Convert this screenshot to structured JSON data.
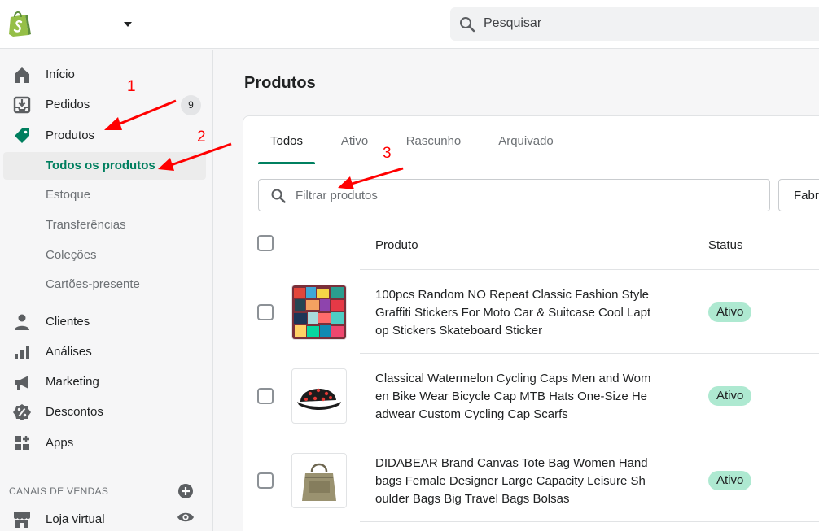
{
  "topbar": {
    "search_label": "Pesquisar"
  },
  "sidebar": {
    "items": [
      {
        "label": "Início",
        "icon": "home-icon"
      },
      {
        "label": "Pedidos",
        "icon": "orders-icon",
        "badge": "9"
      },
      {
        "label": "Produtos",
        "icon": "tag-icon"
      }
    ],
    "sub_items": [
      {
        "label": "Todos os produtos",
        "active": true
      },
      {
        "label": "Estoque"
      },
      {
        "label": "Transferências"
      },
      {
        "label": "Coleções"
      },
      {
        "label": "Cartões-presente"
      }
    ],
    "items2": [
      {
        "label": "Clientes",
        "icon": "person-icon"
      },
      {
        "label": "Análises",
        "icon": "bar-chart-icon"
      },
      {
        "label": "Marketing",
        "icon": "megaphone-icon"
      },
      {
        "label": "Descontos",
        "icon": "discount-icon"
      },
      {
        "label": "Apps",
        "icon": "apps-icon"
      }
    ],
    "section_title": "CANAIS DE VENDAS",
    "channel": {
      "label": "Loja virtual",
      "icon": "store-icon"
    }
  },
  "main": {
    "title": "Produtos",
    "tabs": [
      {
        "label": "Todos",
        "active": true
      },
      {
        "label": "Ativo"
      },
      {
        "label": "Rascunho"
      },
      {
        "label": "Arquivado"
      }
    ],
    "filter_placeholder": "Filtrar produtos",
    "vendor_label": "Fabr",
    "columns": {
      "product": "Produto",
      "status": "Status"
    },
    "products": [
      {
        "title": "100pcs Random NO Repeat Classic Fashion Style Graffiti Stickers For Moto Car & Suitcase Cool Laptop Stickers Skateboard Sticker",
        "status": "Ativo",
        "thumb": "stickers"
      },
      {
        "title": "Classical Watermelon Cycling Caps Men and Women Bike Wear Bicycle Cap MTB Hats One-Size Headwear Custom Cycling Cap Scarfs",
        "status": "Ativo",
        "thumb": "cap"
      },
      {
        "title": "DIDABEAR Brand Canvas Tote Bag Women Handbags Female Designer Large Capacity Leisure Shoulder Bags Big Travel Bags Bolsas",
        "status": "Ativo",
        "thumb": "bag"
      }
    ]
  },
  "annotations": [
    "1",
    "2",
    "3"
  ],
  "colors": {
    "accent": "#008060",
    "active_text": "#007f5f",
    "badge_active": "#aee9d1",
    "annotation": "#ff0000"
  }
}
